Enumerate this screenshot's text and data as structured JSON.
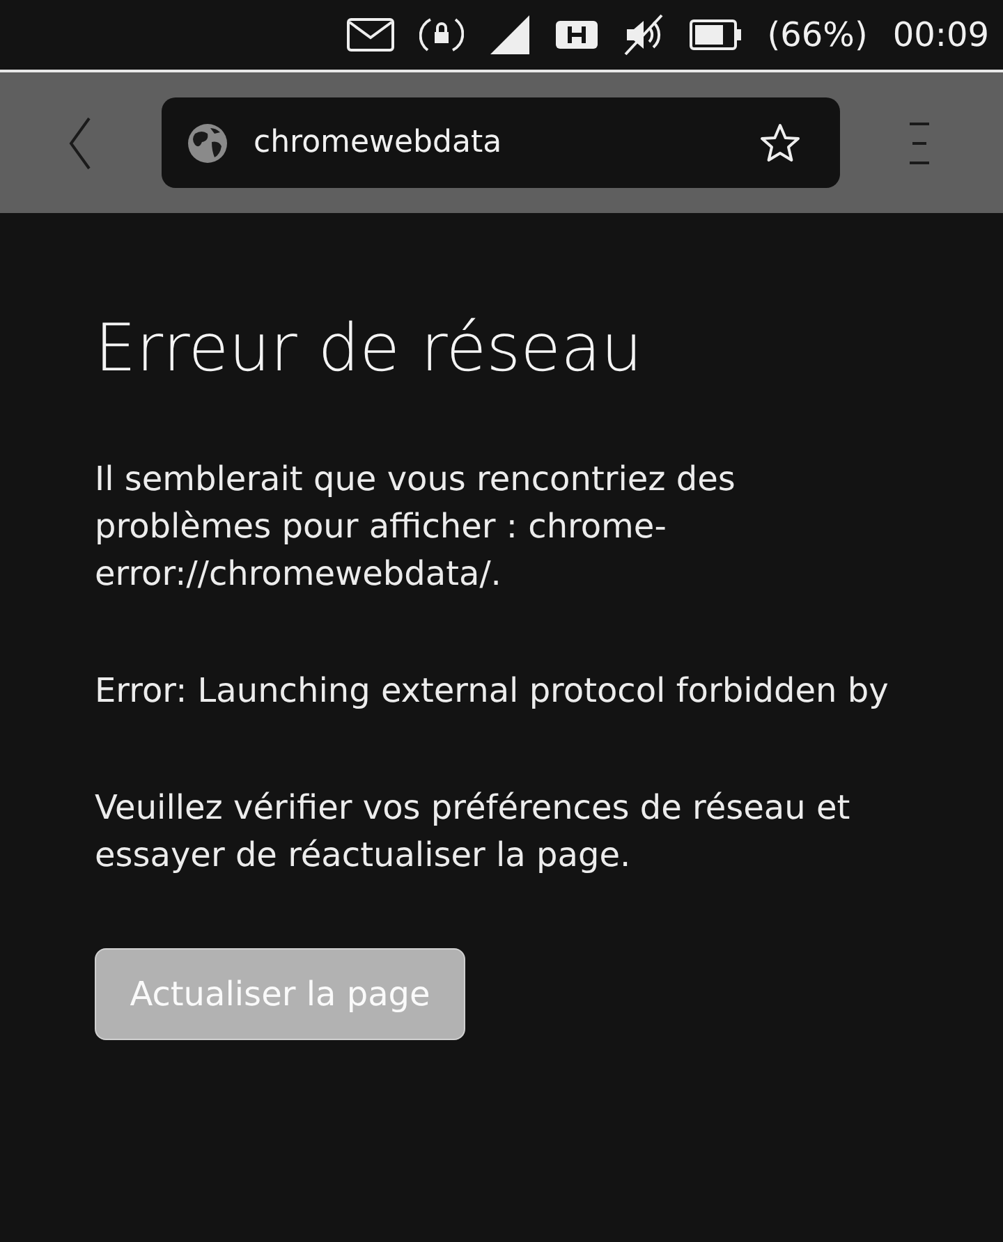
{
  "status_bar": {
    "battery_percent": "(66%)",
    "time": "00:09"
  },
  "toolbar": {
    "address": "chromewebdata"
  },
  "page": {
    "title": "Erreur de réseau",
    "paragraphs": [
      "Il semblerait que vous rencontriez des problèmes pour afficher : chrome-error://chromewebdata/.",
      "Error: Launching external protocol forbidden by",
      "Veuillez vérifier vos préférences de réseau et essayer de réactualiser la page."
    ],
    "button": "Actualiser la page"
  }
}
